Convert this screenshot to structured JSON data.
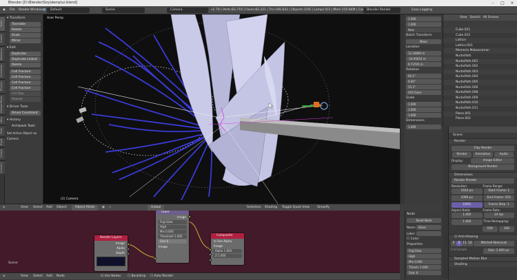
{
  "window": {
    "title": "Blender [D:\\Blender\\Soy\\demp\\ui.blend]"
  },
  "infobar": {
    "menus": [
      "File",
      "Render",
      "Window",
      "Help"
    ],
    "screen": "Default",
    "scene": "Scene",
    "camera": "Camera",
    "stats": "v2.79 | Verts:83,710 | Faces:83,321 | Tris:166,642 | Objects:1/56 | Lamps:0/3 | Mem:150.84M | Camera",
    "engine": "Blender Render",
    "extra": "Easy Logging"
  },
  "left_tabs": [
    "Tools",
    "Create",
    "Relations",
    "Animation",
    "Physics",
    "Grease Pencil",
    "Misc",
    "Tools",
    "Rigid",
    "Create",
    "Convert"
  ],
  "toolshelf": {
    "transform_header": "Transform",
    "transform": [
      "Translate",
      "Rotate",
      "Scale",
      "Mirror"
    ],
    "edit_header": "Edit",
    "edit": [
      "Duplicate",
      "Duplicate Linked",
      "Delete",
      "Cell Fracture",
      "Cell Fracture",
      "Cell Fracture",
      "Cell Fracture"
    ],
    "extra": [
      "Ctrl Rep",
      "Repeat"
    ],
    "driver": "Driver Tools",
    "driver_item": "Driver Constraint",
    "history": "History",
    "history_item": "Archipack Tools",
    "footer": "Set Active Object as Camera"
  },
  "viewport": {
    "label": "User Persp",
    "object": "(2) Camera"
  },
  "vp_header": {
    "items": [
      "View",
      "Select",
      "Add",
      "Object"
    ],
    "mode": "Object Mode",
    "pivot": "Global",
    "right": [
      "Selection",
      "Shading",
      "Toggle Quad View",
      "Simplify"
    ]
  },
  "node_editor": {
    "label": "Scene",
    "render_layers": {
      "title": "Render Layers",
      "outputs": [
        "Image",
        "Alpha",
        "Depth"
      ],
      "layer": "RenderLayer"
    },
    "glare": {
      "title": "Glare",
      "output": "Image",
      "type": "Fog Glow",
      "quality": "High",
      "mix_label": "Mix",
      "mix": "0.000",
      "threshold_label": "Threshold",
      "threshold": "1.000",
      "size_label": "Size",
      "size": "8",
      "input": "Image"
    },
    "composite": {
      "title": "Composite",
      "use_alpha": "Use Alpha",
      "inputs": [
        "Image",
        "Alpha",
        "Z"
      ],
      "alpha": "1.000",
      "z": "1.000"
    }
  },
  "node_header": {
    "items": [
      "View",
      "Select",
      "Add",
      "Node"
    ],
    "use_nodes": "Use Nodes",
    "backdrop": "Backdrop",
    "auto_render": "Auto Render"
  },
  "npanel": {
    "items": [
      "Transform",
      "Location",
      "Rotation",
      "Scale",
      "Dimensions"
    ],
    "values": [
      "12.34894 m",
      "-24.95652 m",
      "9.73765 m",
      "64.1°",
      "0.00°",
      "55.3°",
      "1.000",
      "1.000",
      "1.000",
      "1.000",
      "1.000",
      "1.000"
    ],
    "batch": "Batch Transform",
    "mean": "Mean",
    "rot_mode": "XYZ Euler",
    "new": "New"
  },
  "outliner": {
    "tabs": [
      "View",
      "Search",
      "All Scenes"
    ],
    "items": [
      "Cube.021",
      "Cube.022",
      "Lattice",
      "Lattice.001",
      "Memoria Malwaraman",
      "NurbsPath",
      "NurbsPath.001",
      "NurbsPath.002",
      "NurbsPath.003",
      "NurbsPath.004",
      "NurbsPath.005",
      "NurbsPath.006",
      "NurbsPath.008",
      "NurbsPath.009",
      "NurbsPath.010",
      "NurbsPath.011",
      "Plane.001",
      "Plane.002"
    ]
  },
  "properties": {
    "scene": "Scene",
    "render_header": "Render",
    "render_btn": "Clay Render",
    "buttons": [
      "Render",
      "Animation",
      "Audio"
    ],
    "display_label": "Display:",
    "display": "Image Editor",
    "bg_render": "Background Render",
    "dimensions": "Dimensions",
    "presets": "Render Presets",
    "resolution": "Resolution:",
    "res_x": "1920 px",
    "res_y": "1080 px",
    "res_pct": "100%",
    "frame_range": "Frame Range:",
    "start": "Start Frame: 1",
    "end": "End Frame: 250",
    "step": "Frame Step: 1",
    "aspect": "Aspect Ratio:",
    "ax": "1.000",
    "ay": "1.000",
    "frame_rate": "Frame Rate:",
    "fps": "24 fps",
    "remap": "Time Remapping:",
    "old": "100",
    "new": "100",
    "aa": "Anti-Aliasing",
    "aa_vals": [
      "5",
      "8",
      "11",
      "16"
    ],
    "filter": "Mitchell-Netravali",
    "full_sample": "Full Sample",
    "size": "Size: 1.000 px",
    "motion_blur": "Sampled Motion Blur",
    "shading": "Shading"
  },
  "node_props": {
    "node_header": "Node",
    "reset": "Reset Node",
    "name_label": "Name:",
    "name": "Glare",
    "label_label": "Label:",
    "color": "Color",
    "properties": "Properties",
    "type": "Fog Glow",
    "quality": "High",
    "mix": "Mix 0.000",
    "threshold": "Thresh: 1.000",
    "size": "Size: 8"
  }
}
